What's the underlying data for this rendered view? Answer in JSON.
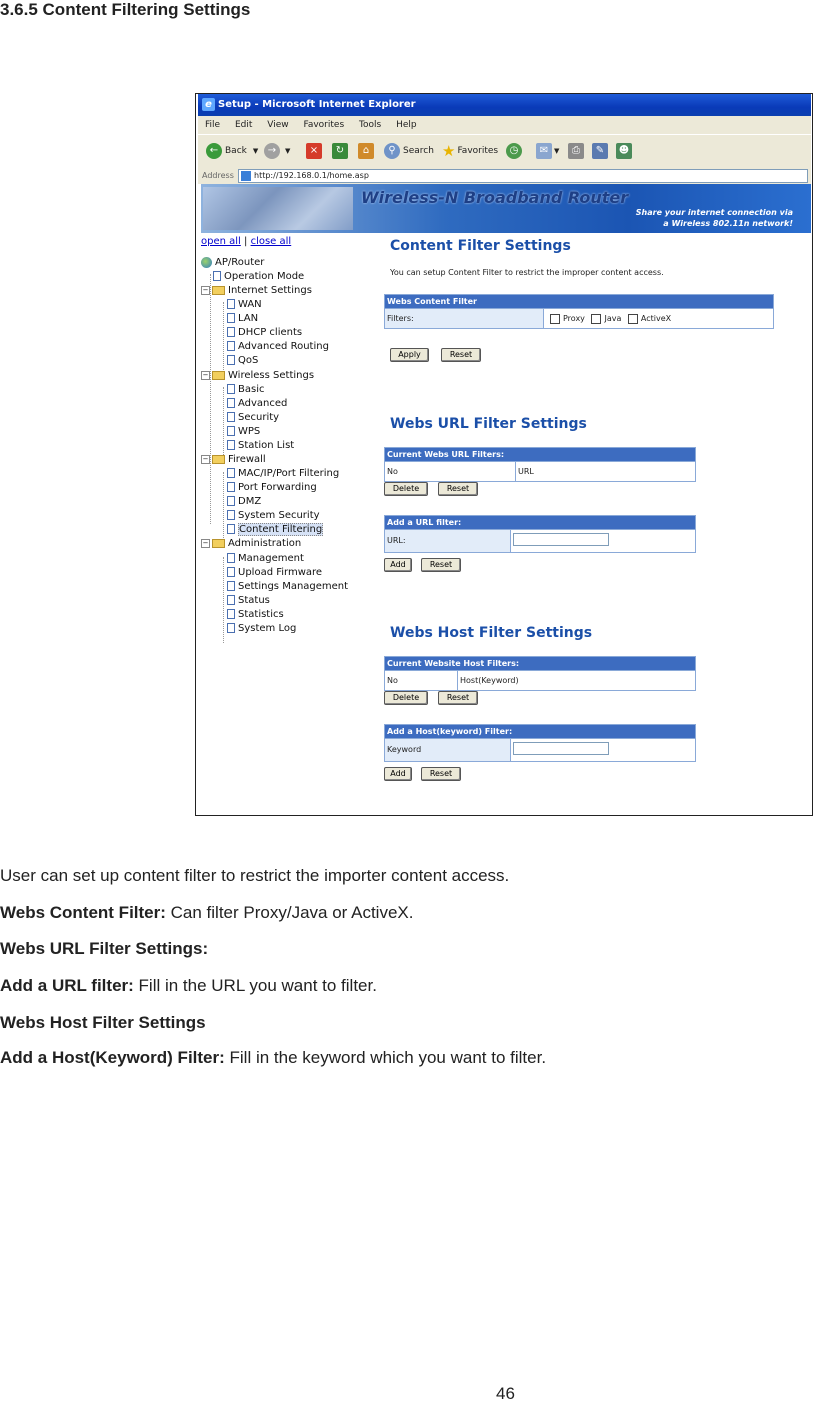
{
  "section_title": "3.6.5 Content Filtering Settings",
  "browser": {
    "window_title": "Setup - Microsoft Internet Explorer",
    "menu": [
      "File",
      "Edit",
      "View",
      "Favorites",
      "Tools",
      "Help"
    ],
    "toolbar": {
      "back": "Back",
      "search": "Search",
      "favorites": "Favorites"
    },
    "address_label": "Address",
    "address_url": "http://192.168.0.1/home.asp"
  },
  "banner": {
    "brand": "Wireless-N Broadband Router",
    "tagline_1": "Share your internet connection via",
    "tagline_2": "a Wireless 802.11n network!"
  },
  "tree": {
    "open_all": "open all",
    "separator": "|",
    "close_all": "close all",
    "root": "AP/Router",
    "items": {
      "operation_mode": "Operation Mode",
      "internet_settings": "Internet Settings",
      "wan": "WAN",
      "lan": "LAN",
      "dhcp": "DHCP clients",
      "adv_routing": "Advanced Routing",
      "qos": "QoS",
      "wireless_settings": "Wireless Settings",
      "basic": "Basic",
      "advanced": "Advanced",
      "security": "Security",
      "wps": "WPS",
      "station_list": "Station List",
      "firewall": "Firewall",
      "mac_filter": "MAC/IP/Port Filtering",
      "port_forwarding": "Port Forwarding",
      "dmz": "DMZ",
      "system_security": "System Security",
      "content_filtering": "Content Filtering",
      "administration": "Administration",
      "management": "Management",
      "upload_firmware": "Upload Firmware",
      "settings_management": "Settings Management",
      "status": "Status",
      "statistics": "Statistics",
      "system_log": "System Log"
    }
  },
  "content": {
    "cf_title": "Content Filter Settings",
    "cf_desc": "You can setup Content Filter to restrict the improper content access.",
    "wcf_header": "Webs Content Filter",
    "filters_label": "Filters:",
    "proxy": "Proxy",
    "java": "Java",
    "activex": "ActiveX",
    "apply": "Apply",
    "reset": "Reset",
    "url_title": "Webs URL Filter Settings",
    "current_url_header": "Current Webs URL Filters:",
    "col_no": "No",
    "col_url": "URL",
    "delete": "Delete",
    "add_url_header": "Add a URL filter:",
    "url_label": "URL:",
    "add": "Add",
    "host_title": "Webs Host Filter Settings",
    "current_host_header": "Current Website Host Filters:",
    "col_host": "Host(Keyword)",
    "add_host_header": "Add a Host(keyword) Filter:",
    "keyword_label": "Keyword"
  },
  "body": {
    "intro": "User can set up content filter to restrict the importer content access.",
    "wcf_label": "Webs Content Filter:",
    "wcf_text": " Can filter Proxy/Java or ActiveX.",
    "url_settings_label": "Webs URL Filter Settings:",
    "add_url_label": "Add a URL filter:",
    "add_url_text": " Fill in the URL you want to filter.",
    "host_settings_label": "Webs Host Filter Settings",
    "add_host_label": "Add a Host(Keyword) Filter:",
    "add_host_text": " Fill in the keyword which you want to filter."
  },
  "page_number": "46"
}
